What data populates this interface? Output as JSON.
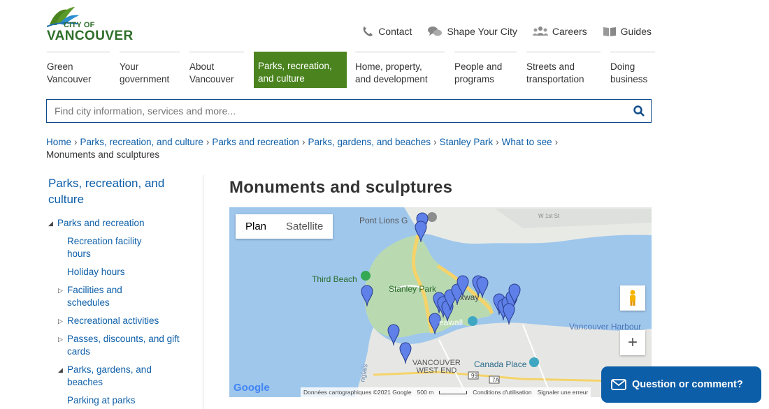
{
  "logo": {
    "line1": "CITY OF",
    "line2": "VANCOUVER"
  },
  "utility_nav": [
    {
      "label": "Contact",
      "icon": "phone-icon"
    },
    {
      "label": "Shape Your City",
      "icon": "chat-bubbles-icon"
    },
    {
      "label": "Careers",
      "icon": "people-icon"
    },
    {
      "label": "Guides",
      "icon": "book-icon"
    }
  ],
  "main_nav": [
    {
      "line1": "Green",
      "line2": "Vancouver"
    },
    {
      "line1": "Your",
      "line2": "government"
    },
    {
      "line1": "About",
      "line2": "Vancouver"
    },
    {
      "line1": "Parks, recreation,",
      "line2": "and culture",
      "active": true
    },
    {
      "line1": "Home, property,",
      "line2": "and development"
    },
    {
      "line1": "People and",
      "line2": "programs"
    },
    {
      "line1": "Streets and",
      "line2": "transportation"
    },
    {
      "line1": "Doing",
      "line2": "business"
    }
  ],
  "search": {
    "placeholder": "Find city information, services and more..."
  },
  "breadcrumb": {
    "links": [
      "Home",
      "Parks, recreation, and culture",
      "Parks and recreation",
      "Parks, gardens, and beaches",
      "Stanley Park",
      "What to see"
    ],
    "separator": "›",
    "current": "Monuments and sculptures"
  },
  "sidebar": {
    "title": "Parks, recreation, and culture",
    "items": [
      {
        "label": "Parks and recreation",
        "marker": "◢"
      },
      {
        "label": "Recreation facility hours"
      },
      {
        "label": "Holiday hours"
      },
      {
        "label": "Facilities and schedules",
        "marker": "▷"
      },
      {
        "label": "Recreational activities",
        "marker": "▷"
      },
      {
        "label": "Passes, discounts, and gift cards",
        "marker": "▷"
      },
      {
        "label": "Parks, gardens, and beaches",
        "marker": "◢"
      },
      {
        "label": "Parking at parks"
      }
    ]
  },
  "page_title": "Monuments and sculptures",
  "map": {
    "toggle": {
      "plan": "Plan",
      "satellite": "Satellite"
    },
    "labels": {
      "pont_lions": "Pont Lions G",
      "third_beach": "Third Beach",
      "stanley_park": "Stanley Park",
      "causeway": "xway",
      "seawall": "eawall",
      "vancouver_harbour": "Vancouver Harbour",
      "west_end": "VANCOUVER\nWEST END",
      "canada_place": "Canada Place",
      "street_w1": "W 1st St",
      "hwy99": "99",
      "hwy7a": "7A",
      "english_bay": "nglais"
    },
    "logo": "Google",
    "attribution": {
      "data": "Données cartographiques ©2021 Google",
      "scale": "500 m",
      "terms": "Conditions d'utilisation",
      "report": "Signaler une erreur"
    },
    "zoom_in": "+"
  },
  "feedback_button": {
    "label": "Question or comment?"
  },
  "colors": {
    "brand_green": "#4b841f",
    "link_blue": "#0c5ea8",
    "marker": "#5e80e8"
  }
}
